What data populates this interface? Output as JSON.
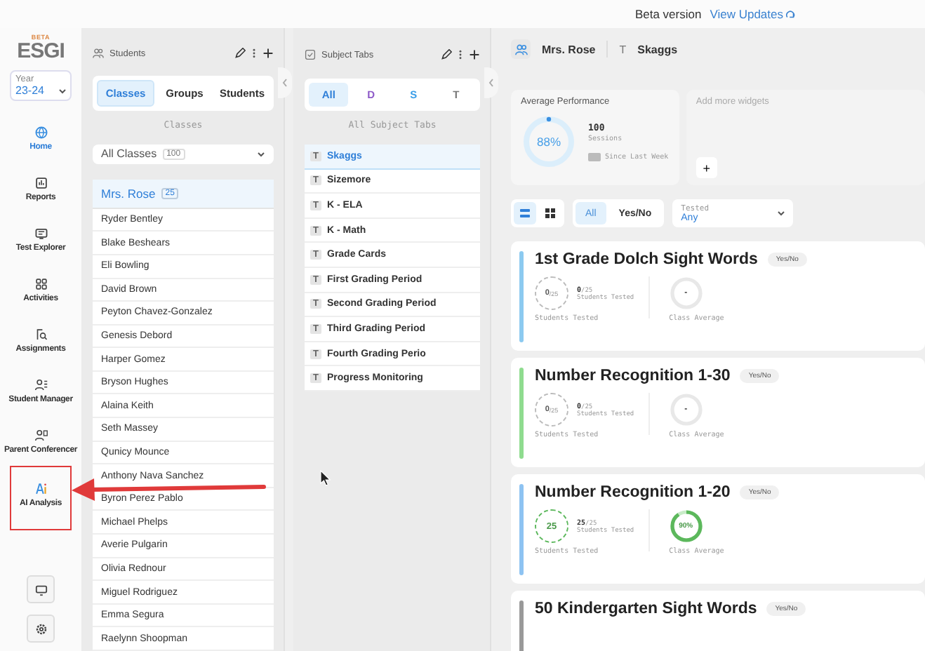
{
  "top_bar": {
    "label": "Beta version",
    "link": "View Updates"
  },
  "logo": {
    "badge": "BETA",
    "text": "ESGI"
  },
  "year": {
    "label": "Year",
    "value": "23-24"
  },
  "nav": [
    {
      "label": "Home",
      "selected": true
    },
    {
      "label": "Reports",
      "selected": false
    },
    {
      "label": "Test Explorer",
      "selected": false
    },
    {
      "label": "Activities",
      "selected": false
    },
    {
      "label": "Assignments",
      "selected": false
    },
    {
      "label": "Student Manager",
      "selected": false
    },
    {
      "label": "Parent Conferencer",
      "selected": false
    },
    {
      "label": "AI Analysis",
      "selected": false
    }
  ],
  "students_panel": {
    "title": "Students",
    "tabs": [
      {
        "label": "Classes",
        "selected": true
      },
      {
        "label": "Groups",
        "selected": false
      },
      {
        "label": "Students",
        "selected": false
      }
    ],
    "subtitle": "Classes",
    "dropdown": {
      "label": "All Classes",
      "count": "100"
    },
    "class": {
      "name": "Mrs. Rose",
      "count": "25",
      "selected": true
    },
    "students": [
      "Ryder Bentley",
      "Blake Beshears",
      "Eli Bowling",
      "David Brown",
      "Peyton Chavez-Gonzalez",
      "Genesis Debord",
      "Harper Gomez",
      "Bryson Hughes",
      "Alaina Keith",
      "Seth Massey",
      "Qunicy Mounce",
      "Anthony Nava Sanchez",
      "Byron Perez Pablo",
      "Michael Phelps",
      "Averie Pulgarin",
      "Olivia Rednour",
      "Miguel Rodriguez",
      "Emma Segura",
      "Raelynn Shoopman"
    ]
  },
  "subject_panel": {
    "title": "Subject Tabs",
    "filters": [
      {
        "label": "All",
        "selected": true,
        "color": "#2f7fd8"
      },
      {
        "label": "D",
        "selected": false,
        "color": "#8e5bc8"
      },
      {
        "label": "S",
        "selected": false,
        "color": "#3a9ee8"
      },
      {
        "label": "T",
        "selected": false,
        "color": "#777777"
      }
    ],
    "subtitle": "All Subject Tabs",
    "tabs": [
      {
        "badge": "T",
        "name": "Skaggs",
        "selected": true
      },
      {
        "badge": "T",
        "name": "Sizemore",
        "selected": false
      },
      {
        "badge": "T",
        "name": "K - ELA",
        "selected": false
      },
      {
        "badge": "T",
        "name": "K - Math",
        "selected": false
      },
      {
        "badge": "T",
        "name": "Grade Cards",
        "selected": false
      },
      {
        "badge": "T",
        "name": "First Grading Period",
        "selected": false
      },
      {
        "badge": "T",
        "name": "Second Grading Period",
        "selected": false
      },
      {
        "badge": "T",
        "name": "Third Grading Period",
        "selected": false
      },
      {
        "badge": "T",
        "name": "Fourth Grading Perio",
        "selected": false
      },
      {
        "badge": "T",
        "name": "Progress Monitoring",
        "selected": false
      }
    ]
  },
  "header": {
    "class_name": "Mrs. Rose",
    "tab_badge": "T",
    "tab_name": "Skaggs"
  },
  "average_widget": {
    "title": "Average Performance",
    "percent": "88%",
    "sessions": "100",
    "sessions_label": "Sessions",
    "since": "Since Last Week"
  },
  "add_widget": {
    "title": "Add more widgets",
    "button": "+"
  },
  "toolbar": {
    "views": [
      {
        "kind": "list",
        "selected": true
      },
      {
        "kind": "grid",
        "selected": false
      }
    ],
    "filters": [
      {
        "label": "All",
        "selected": true
      },
      {
        "label": "Yes/No",
        "selected": false
      }
    ],
    "dropdown": {
      "label": "Tested",
      "value": "Any"
    }
  },
  "tests": [
    {
      "name": "1st Grade Dolch Sight Words",
      "type": "Yes/No",
      "color": "#8ccaf0",
      "tested": {
        "ring": "0",
        "small": "/25",
        "count": "0",
        "of": "/25",
        "label": "Students Tested",
        "done": false
      },
      "tested_caption": "Students Tested",
      "average": {
        "value": "-",
        "label": "Class Average"
      }
    },
    {
      "name": "Number Recognition 1-30",
      "type": "Yes/No",
      "color": "#8fdc8f",
      "tested": {
        "ring": "0",
        "small": "/25",
        "count": "0",
        "of": "/25",
        "label": "Students Tested",
        "done": false
      },
      "tested_caption": "Students Tested",
      "average": {
        "value": "-",
        "label": "Class Average"
      }
    },
    {
      "name": "Number Recognition 1-20",
      "type": "Yes/No",
      "color": "#8ec3f2",
      "tested": {
        "ring": "25",
        "count": "25",
        "of": "/25",
        "label": "Students Tested",
        "done": true
      },
      "tested_caption": "Students Tested",
      "average": {
        "value": "90%",
        "label": "Class Average",
        "level": 0.9
      }
    },
    {
      "name": "50 Kindergarten Sight Words",
      "type": "Yes/No",
      "color": "#999999"
    }
  ]
}
